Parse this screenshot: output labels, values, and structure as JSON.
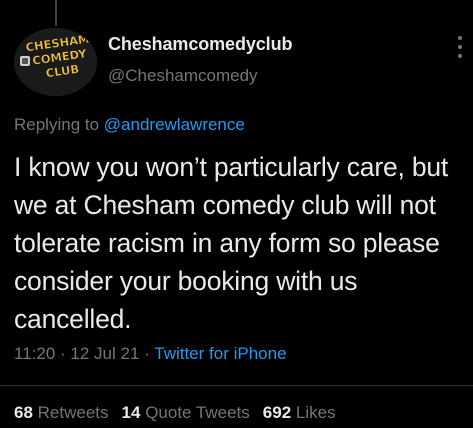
{
  "author": {
    "display_name": "Cheshamcomedyclub",
    "handle": "@Cheshamcomedy",
    "avatar_text": [
      "CHESHAM",
      "COMEDY",
      "CLUB"
    ]
  },
  "reply": {
    "prefix": "Replying to",
    "mention": "@andrewlawrence"
  },
  "tweet": {
    "text": "I know you won’t particularly care, but we at Chesham comedy club will not tolerate racism in any form so please consider your booking with us cancelled."
  },
  "meta": {
    "time": "11:20",
    "date": "12 Jul 21",
    "separator": "·",
    "source": "Twitter for iPhone"
  },
  "stats": {
    "retweets_count": "68",
    "retweets_label": "Retweets",
    "quote_tweets_count": "14",
    "quote_tweets_label": "Quote Tweets",
    "likes_count": "692",
    "likes_label": "Likes"
  },
  "icons": {
    "more": "more-vertical-icon"
  },
  "colors": {
    "background": "#000000",
    "primary_text": "#e7e9ea",
    "secondary_text": "#71767b",
    "accent": "#1d9bf0",
    "avatar_text": "#f2c230"
  }
}
